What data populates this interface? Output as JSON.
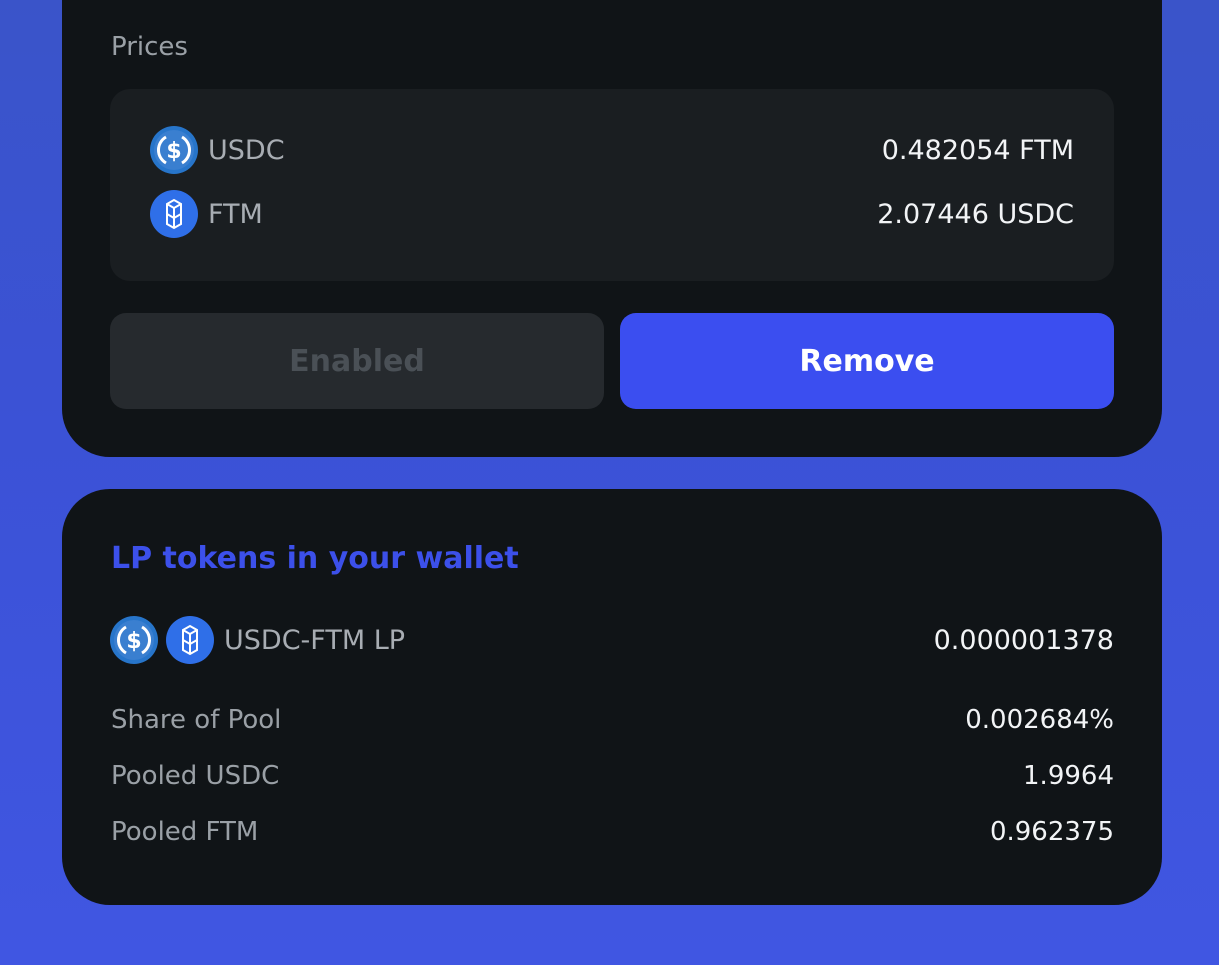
{
  "prices": {
    "section_label": "Prices",
    "rows": [
      {
        "token": "USDC",
        "icon": "usdc-icon",
        "value": "0.482054 FTM"
      },
      {
        "token": "FTM",
        "icon": "ftm-icon",
        "value": "2.07446 USDC"
      }
    ]
  },
  "actions": {
    "enabled_label": "Enabled",
    "remove_label": "Remove"
  },
  "lp": {
    "title": "LP tokens in your wallet",
    "pair_name": "USDC-FTM LP",
    "pair_amount": "0.000001378",
    "stats": [
      {
        "label": "Share of Pool",
        "value": "0.002684%"
      },
      {
        "label": "Pooled USDC",
        "value": "1.9964"
      },
      {
        "label": "Pooled FTM",
        "value": "0.962375"
      }
    ]
  },
  "colors": {
    "accent": "#3b4ef0",
    "card_bg": "#101417",
    "usdc_blue": "#2775ca",
    "ftm_blue": "#1969ff"
  }
}
